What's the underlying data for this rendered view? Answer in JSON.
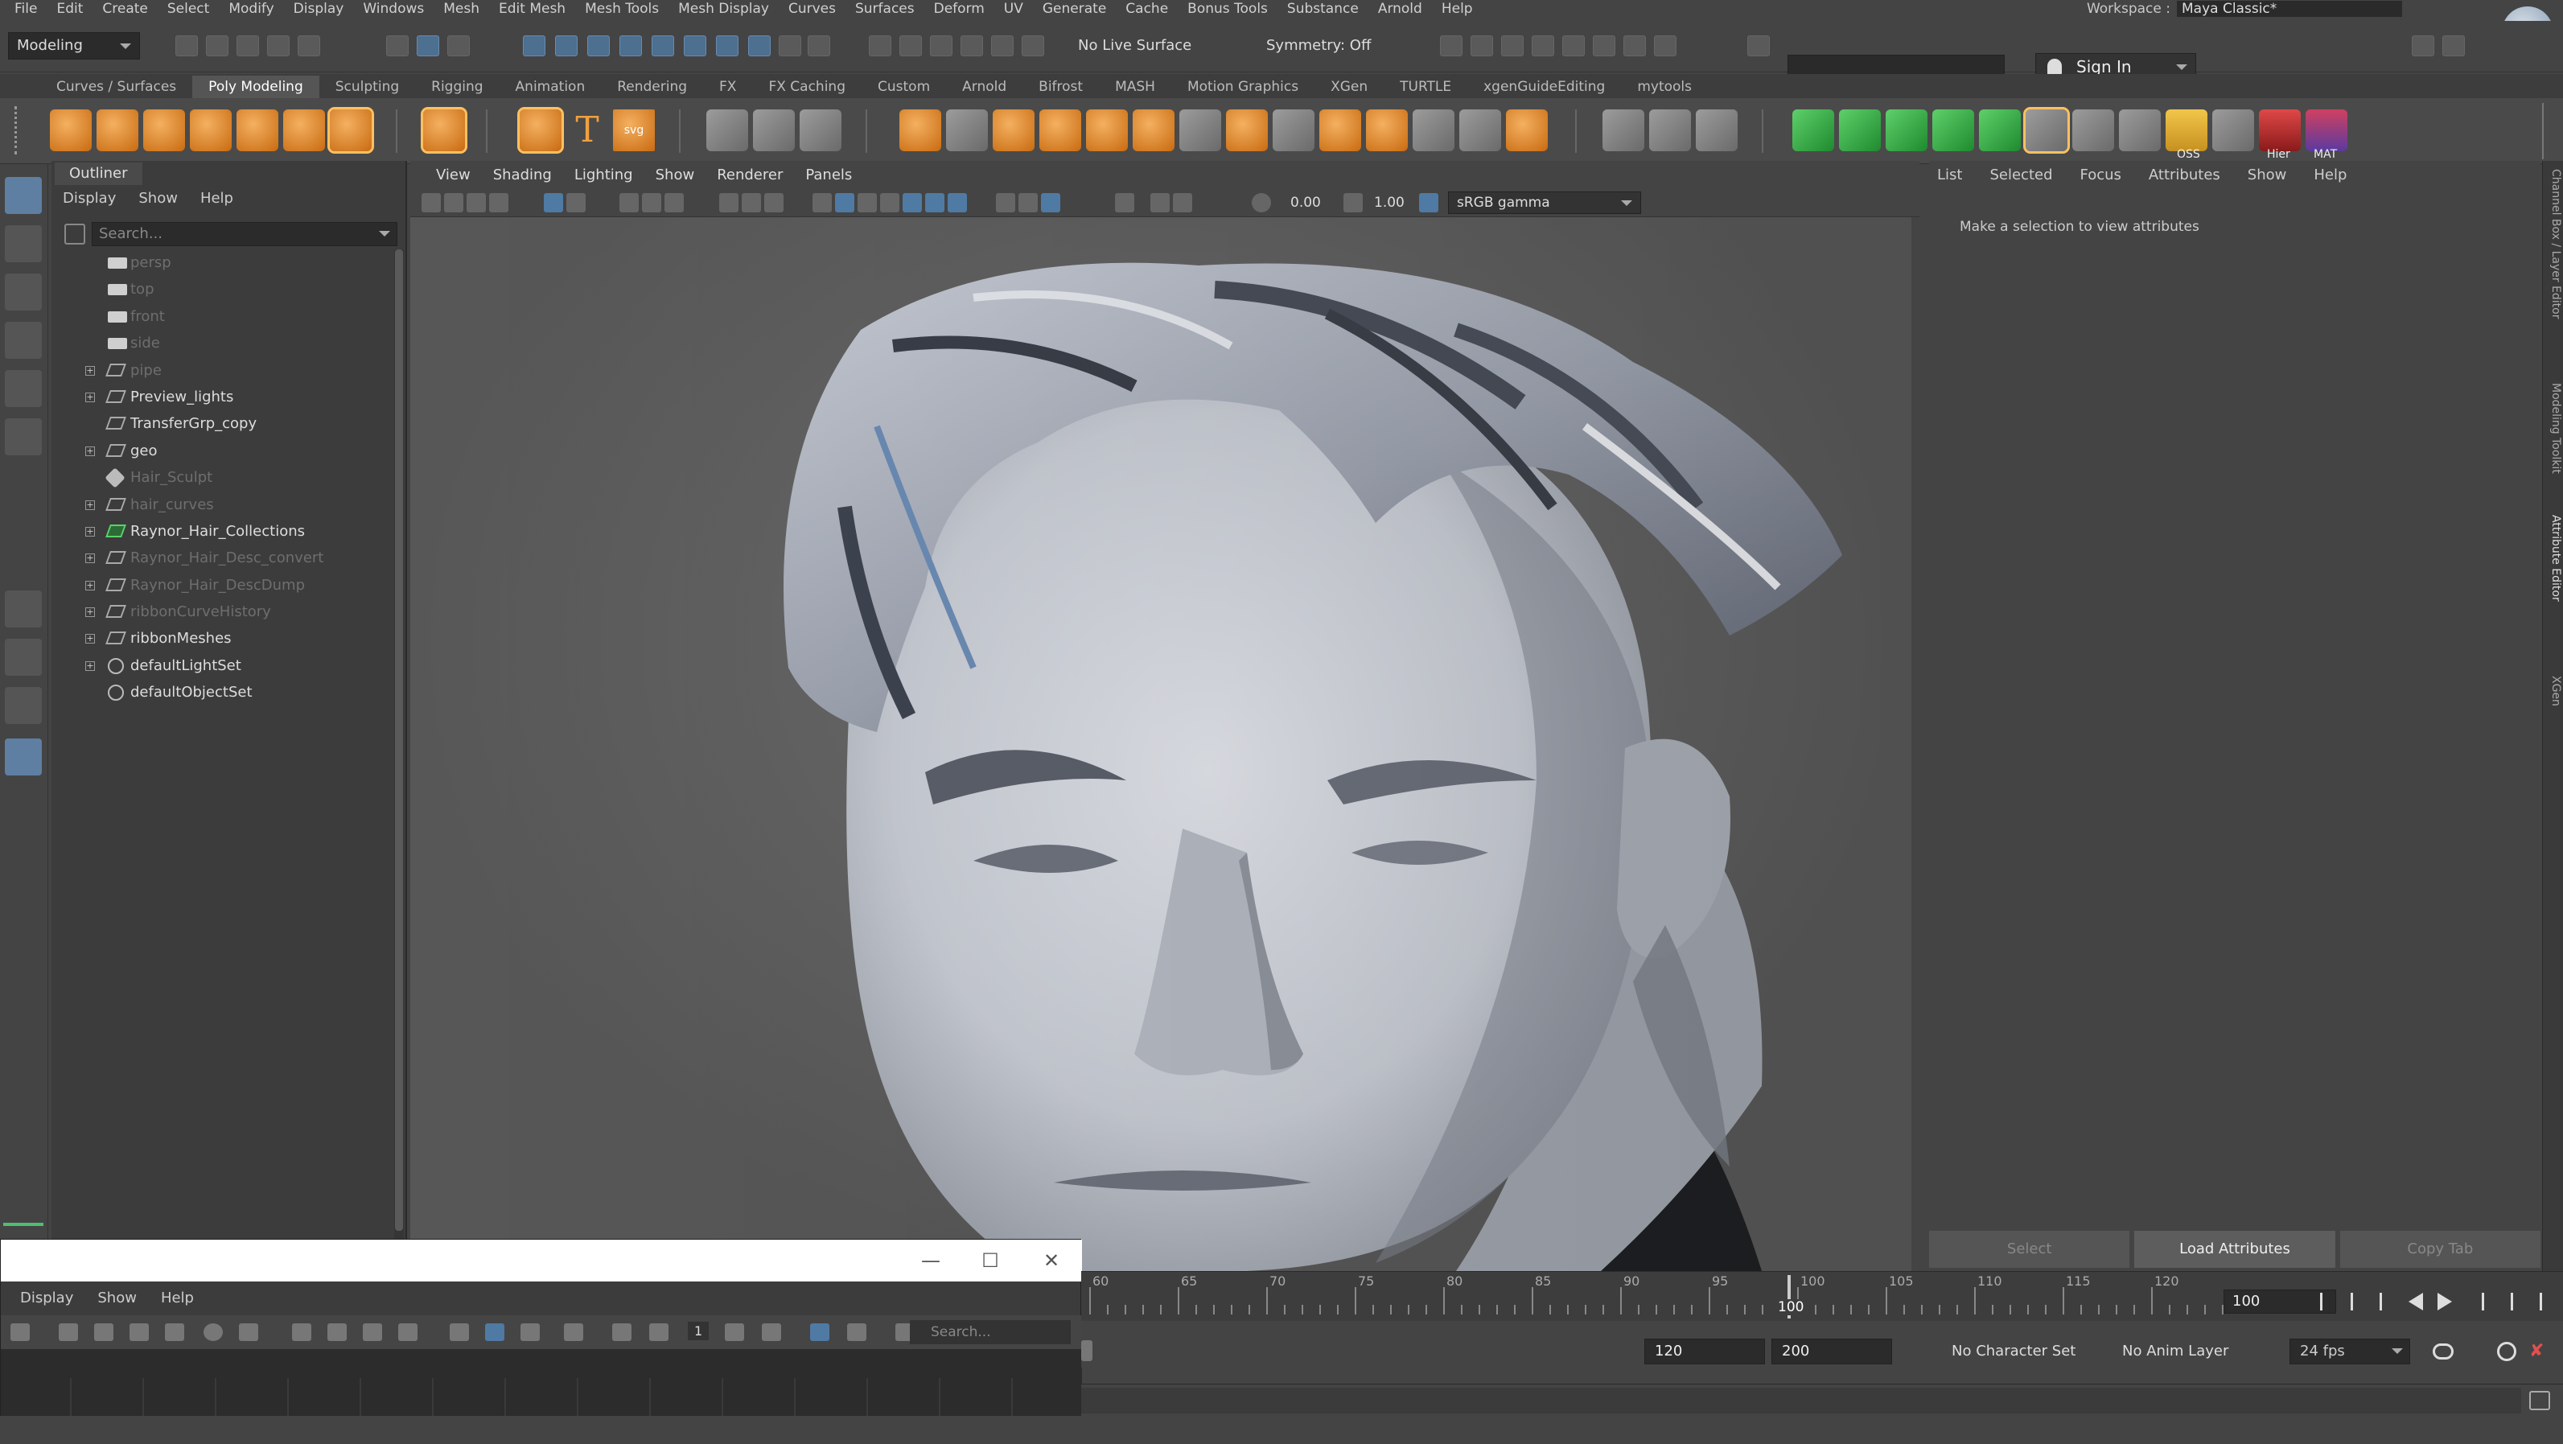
{
  "menubar": {
    "items": [
      "File",
      "Edit",
      "Create",
      "Select",
      "Modify",
      "Display",
      "Windows",
      "Mesh",
      "Edit Mesh",
      "Mesh Tools",
      "Mesh Display",
      "Curves",
      "Surfaces",
      "Deform",
      "UV",
      "Generate",
      "Cache",
      "Bonus Tools",
      "Substance",
      "Arnold",
      "Help"
    ],
    "workspace_label": "Workspace :",
    "workspace_value": "Maya Classic*"
  },
  "statusline": {
    "mode": "Modeling",
    "live_surface": "No Live Surface",
    "symmetry": "Symmetry: Off",
    "sign_in": "Sign In"
  },
  "shelf_tabs": [
    "Curves / Surfaces",
    "Poly Modeling",
    "Sculpting",
    "Rigging",
    "Animation",
    "Rendering",
    "FX",
    "FX Caching",
    "Custom",
    "Arnold",
    "Bifrost",
    "MASH",
    "Motion Graphics",
    "XGen",
    "TURTLE",
    "xgenGuideEditing",
    "mytools"
  ],
  "shelf_active_tab": "Poly Modeling",
  "shelf_labels": {
    "oss": "OSS",
    "hier": "Hier",
    "mat": "MAT"
  },
  "outliner": {
    "title": "Outliner",
    "menu": [
      "Display",
      "Show",
      "Help"
    ],
    "search_placeholder": "Search...",
    "items": [
      {
        "label": "persp",
        "icon": "camera-icon",
        "dim": true,
        "expandable": false
      },
      {
        "label": "top",
        "icon": "camera-icon",
        "dim": true,
        "expandable": false
      },
      {
        "label": "front",
        "icon": "camera-icon",
        "dim": true,
        "expandable": false
      },
      {
        "label": "side",
        "icon": "camera-icon",
        "dim": true,
        "expandable": false
      },
      {
        "label": "pipe",
        "icon": "group-icon",
        "dim": true,
        "expandable": true
      },
      {
        "label": "Preview_lights",
        "icon": "group-icon",
        "dim": false,
        "expandable": true
      },
      {
        "label": "TransferGrp_copy",
        "icon": "group-icon",
        "dim": false,
        "expandable": false
      },
      {
        "label": "geo",
        "icon": "group-icon",
        "dim": false,
        "expandable": true
      },
      {
        "label": "Hair_Sculpt",
        "icon": "node-icon",
        "dim": true,
        "expandable": false
      },
      {
        "label": "hair_curves",
        "icon": "group-icon",
        "dim": true,
        "expandable": true
      },
      {
        "label": "Raynor_Hair_Collections",
        "icon": "xgen-collection-icon",
        "dim": false,
        "expandable": true
      },
      {
        "label": "Raynor_Hair_Desc_convert",
        "icon": "group-icon",
        "dim": true,
        "expandable": true
      },
      {
        "label": "Raynor_Hair_DescDump",
        "icon": "group-icon",
        "dim": true,
        "expandable": true
      },
      {
        "label": "ribbonCurveHistory",
        "icon": "group-icon",
        "dim": true,
        "expandable": true
      },
      {
        "label": "ribbonMeshes",
        "icon": "group-icon",
        "dim": false,
        "expandable": true
      },
      {
        "label": "defaultLightSet",
        "icon": "set-icon",
        "dim": false,
        "expandable": true
      },
      {
        "label": "defaultObjectSet",
        "icon": "set-icon",
        "dim": false,
        "expandable": false
      }
    ]
  },
  "viewport": {
    "menu": [
      "View",
      "Shading",
      "Lighting",
      "Show",
      "Renderer",
      "Panels"
    ],
    "exposure": "0.00",
    "gamma": "1.00",
    "color_space": "sRGB gamma"
  },
  "attribute_editor": {
    "menu": [
      "List",
      "Selected",
      "Focus",
      "Attributes",
      "Show",
      "Help"
    ],
    "message": "Make a selection to view attributes",
    "buttons": {
      "select": "Select",
      "load": "Load Attributes",
      "copy": "Copy Tab"
    }
  },
  "side_tabs": [
    "Channel Box / Layer Editor",
    "Modeling Toolkit",
    "Attribute Editor",
    "XGen"
  ],
  "timeslider": {
    "ticks": [
      "60",
      "65",
      "70",
      "75",
      "80",
      "85",
      "90",
      "95",
      "100",
      "105",
      "110",
      "115",
      "120"
    ],
    "current_frame": "100",
    "current_field": "100"
  },
  "range": {
    "end": "120",
    "anim_end": "200",
    "character_set": "No Character Set",
    "anim_layer": "No Anim Layer",
    "fps": "24 fps"
  },
  "float_window": {
    "menu": [
      "Display",
      "Show",
      "Help"
    ],
    "search_placeholder": "Search...",
    "field_value": "1"
  }
}
